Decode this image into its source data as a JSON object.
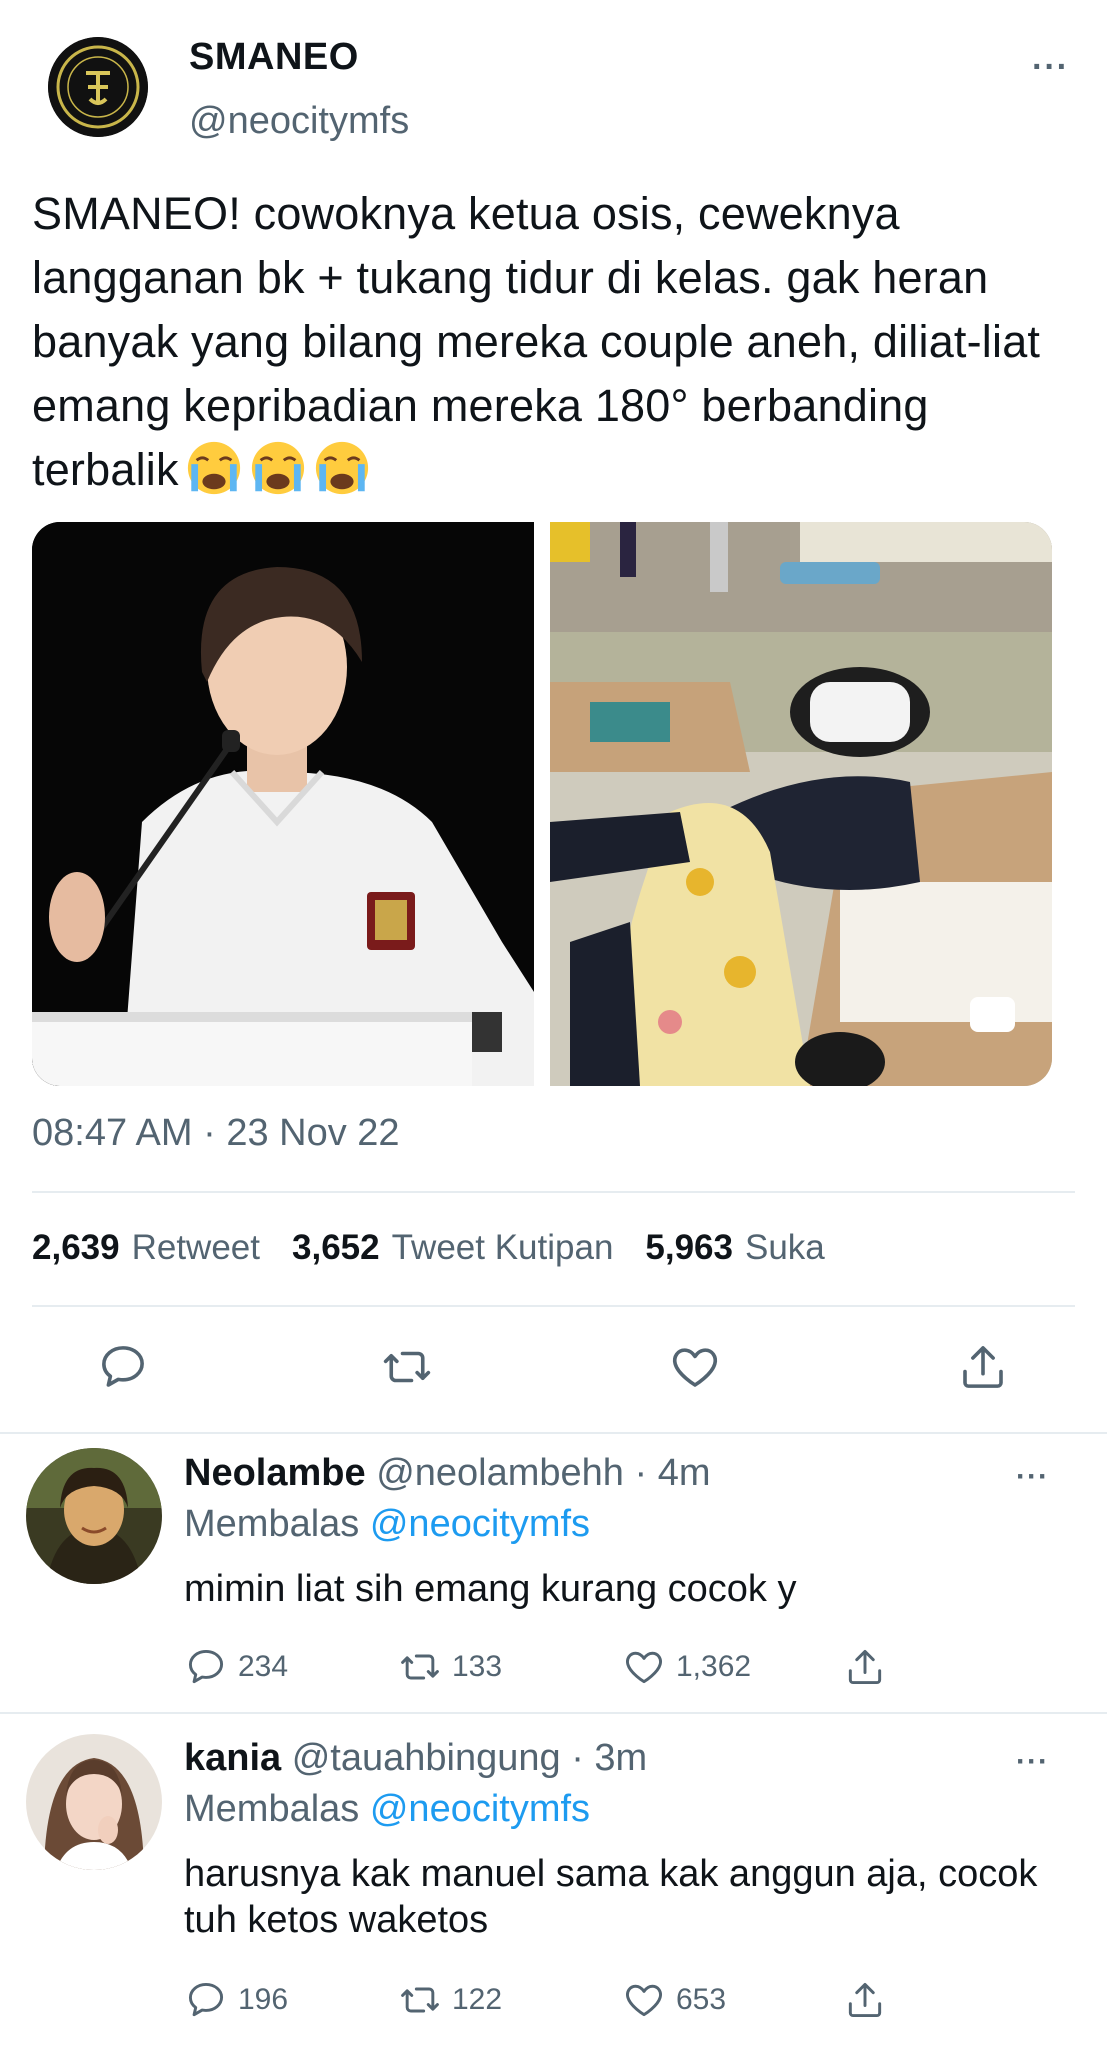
{
  "tweet": {
    "author_name": "SMANEO",
    "author_handle": "@neocitymfs",
    "text": "SMANEO! cowoknya ketua osis, ceweknya langganan bk + tukang tidur di kelas. gak heran banyak yang bilang mereka couple aneh, diliat-liat emang kepribadian mereka 180° berbanding terbalik",
    "emoji": [
      "loudly-crying-face",
      "loudly-crying-face",
      "loudly-crying-face"
    ],
    "timestamp": "08:47 AM · 23 Nov 22",
    "stats": {
      "retweets_value": "2,639",
      "retweets_label": "Retweet",
      "quotes_value": "3,652",
      "quotes_label": "Tweet Kutipan",
      "likes_value": "5,963",
      "likes_label": "Suka"
    },
    "more_label": "···"
  },
  "replies": [
    {
      "name": "Neolambe",
      "handle": "@neolambehh · 4m",
      "replying_prefix": "Membalas",
      "replying_to": "@neocitymfs",
      "text": "mimin liat sih emang kurang cocok y",
      "replies_count": "234",
      "retweets_count": "133",
      "likes_count": "1,362",
      "more_label": "···"
    },
    {
      "name": "kania",
      "handle": "@tauahbingung · 3m",
      "replying_prefix": "Membalas",
      "replying_to": "@neocitymfs",
      "text": "harusnya kak manuel sama kak anggun aja, cocok tuh ketos waketos",
      "replies_count": "196",
      "retweets_count": "122",
      "likes_count": "653",
      "more_label": "···"
    }
  ],
  "colors": {
    "text": "#0f1419",
    "muted": "#536471",
    "link": "#1d9bf0",
    "divider": "#e6ecf0"
  },
  "icons": [
    "reply-icon",
    "retweet-icon",
    "like-icon",
    "share-icon",
    "more-icon"
  ]
}
